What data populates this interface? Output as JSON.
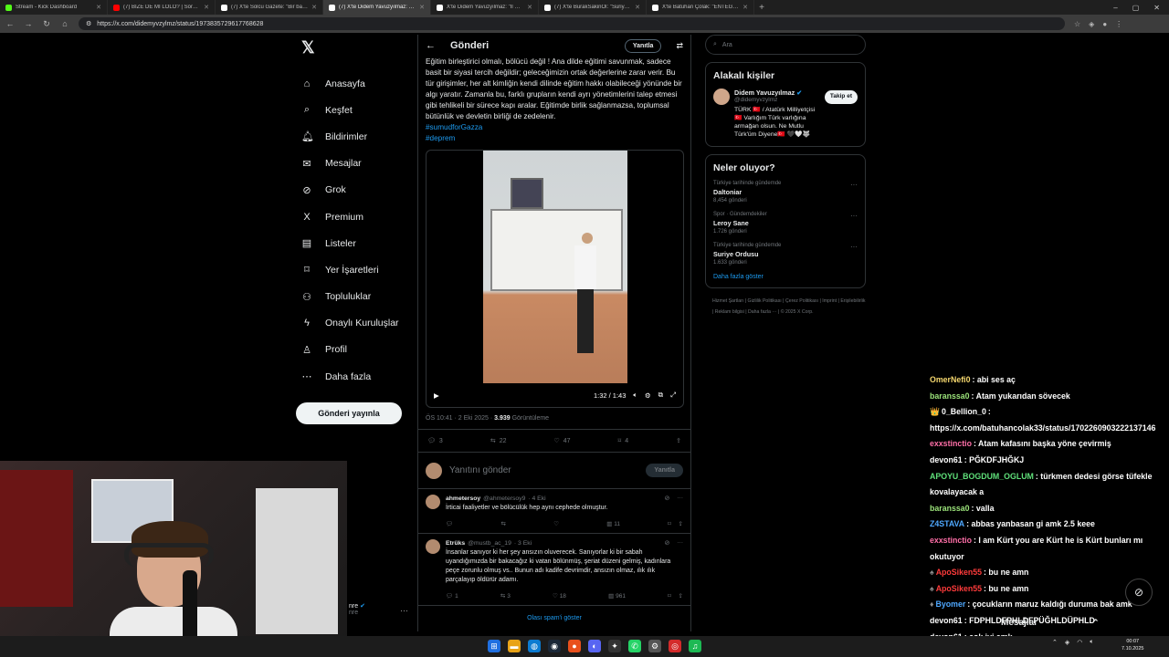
{
  "browser": {
    "tabs": [
      {
        "title": "Stream - Kick Dashboard",
        "color": "#53fc18",
        "active": false
      },
      {
        "title": "(7) BİZE DE Mİ LOLO? | Sörders |",
        "color": "#ff0000",
        "active": false
      },
      {
        "title": "(7) X'te Solcu Gazete: \"Bir baba, k",
        "color": "#ffffff",
        "active": false
      },
      {
        "title": "(7) X'te Didem Yavuzyılmaz: \"İl Mi",
        "color": "#ffffff",
        "active": true
      },
      {
        "title": "X'te Didem Yavuzyılmaz: \"İl MİLL",
        "color": "#ffffff",
        "active": false
      },
      {
        "title": "(7) X'te BurakSakinOl: \"Suriye'de",
        "color": "#ffffff",
        "active": false
      },
      {
        "title": "X'te Batuhan Çolak: \"ENTEGRASY",
        "color": "#ffffff",
        "active": false
      }
    ],
    "url": "https://x.com/didemyvzylmz/status/1973835729617768628"
  },
  "nav": {
    "items": [
      {
        "label": "Anasayfa",
        "icon": "⌂",
        "icon_name": "home-icon"
      },
      {
        "label": "Keşfet",
        "icon": "⌕",
        "icon_name": "explore-icon"
      },
      {
        "label": "Bildirimler",
        "icon": "🔔︎",
        "icon_name": "bell-icon",
        "badge": "7"
      },
      {
        "label": "Mesajlar",
        "icon": "✉",
        "icon_name": "mail-icon"
      },
      {
        "label": "Grok",
        "icon": "⊘",
        "icon_name": "grok-icon"
      },
      {
        "label": "Premium",
        "icon": "X",
        "icon_name": "premium-icon"
      },
      {
        "label": "Listeler",
        "icon": "▤",
        "icon_name": "list-icon"
      },
      {
        "label": "Yer İşaretleri",
        "icon": "⌑",
        "icon_name": "bookmark-icon"
      },
      {
        "label": "Topluluklar",
        "icon": "⚇",
        "icon_name": "communities-icon"
      },
      {
        "label": "Onaylı Kuruluşlar",
        "icon": "ϟ",
        "icon_name": "verified-orgs-icon"
      },
      {
        "label": "Profil",
        "icon": "♙",
        "icon_name": "profile-icon"
      },
      {
        "label": "Daha fazla",
        "icon": "⋯",
        "icon_name": "more-icon"
      }
    ],
    "post_button": "Gönderi yayınla",
    "account_name": "nre",
    "account_handle": "nre"
  },
  "post": {
    "header_title": "Gönderi",
    "reply_pill": "Yanıtla",
    "text": "Eğitim birleştirici olmalı, bölücü değil ! Ana dilde eğitimi savunmak, sadece basit bir siyasi tercih değildir; geleceğimizin ortak değerlerine zarar verir. Bu tür girişimler, her alt kimliğin kendi dilinde eğitim hakkı olabileceği yönünde bir algı yaratır. Zamanla bu, farklı grupların kendi ayrı yönetimlerini talep etmesi gibi tehlikeli bir sürece kapı aralar. Eğitimde birlik sağlanmazsa, toplumsal bütünlük ve devletin birliği de zedelenir.",
    "hashtags": [
      "#sumudforGazza",
      "#deprem"
    ],
    "video_time": "1:32 / 1:43",
    "time": "ÖS 10:41 · 2 Eki 2025 ·",
    "views": "3.939",
    "views_label": "Görüntüleme",
    "counts": {
      "replies": "3",
      "reposts": "22",
      "likes": "47",
      "bookmarks": "4"
    },
    "compose_placeholder": "Yanıtını gönder",
    "compose_button": "Yanıtla"
  },
  "replies": [
    {
      "name": "ahmetersoy",
      "handle": "@ahmetersoy9",
      "date": "· 4 Eki",
      "text": "İrticai faaliyetler ve bölücülük hep aynı cephede olmuştur.",
      "replies": "",
      "reposts": "",
      "likes": "",
      "views": "11"
    },
    {
      "name": "Etrüks",
      "handle": "@mustb_ac_19",
      "date": "· 3 Eki",
      "text": "İnsanlar sanıyor ki her şey ansızın oluverecek. Sanıyorlar ki bir sabah uyandığımızda bir bakacağız ki vatan bölünmüş, şeriat düzeni gelmiş, kadınlara peçe zorunlu olmuş vs.. Bunun adı kadife devrimdir, ansızın olmaz, ılık ılık parçalayıp öldürür adamı.",
      "replies": "1",
      "reposts": "3",
      "likes": "18",
      "views": "961"
    }
  ],
  "spam_link": "Olası spam'i göster",
  "sidebar": {
    "search_placeholder": "Ara",
    "relevant_title": "Alakalı kişiler",
    "person": {
      "name": "Didem Yavuzyılmaz",
      "handle": "@didemyvzylmz",
      "follow": "Takip et",
      "bio": "TÜRK 🇹🇷 / Atatürk Milliyetçisi 🇹🇷 Varlığım Türk varlığına armağan olsun. Ne Mutlu Türk'üm Diyene🇹🇷 🖤🤍🐺"
    },
    "trends_title": "Neler oluyor?",
    "trends": [
      {
        "context": "Türkiye tarihinde gündemde",
        "name": "Daltoniar",
        "count": "8,454 gönderi"
      },
      {
        "context": "Spor · Gündemdekiler",
        "name": "Leroy Sane",
        "count": "1.726 gönderi"
      },
      {
        "context": "Türkiye tarihinde gündemde",
        "name": "Suriye Ordusu",
        "count": "1.633 gönderi"
      }
    ],
    "show_more": "Daha fazla göster",
    "footer": [
      "Hizmet Şartları",
      "Gizlilik Politikası",
      "Çerez Politikası",
      "Imprint",
      "Erişilebilirlik",
      "Reklam bilgisi",
      "Daha fazla ···",
      "© 2025 X Corp."
    ]
  },
  "chat": [
    {
      "user": "OmerNefi0",
      "color": "#f5d76e",
      "text": "abi ses aç"
    },
    {
      "user": "baranssa0",
      "color": "#9be37a",
      "text": "Atam yukarıdan sövecek"
    },
    {
      "user": "0_Bellion_0",
      "color": "#ffffff",
      "text": "https://x.com/batuhancolak33/status/1702260903222137146",
      "badge": "👑"
    },
    {
      "user": "exxstinctio",
      "color": "#ff6fa8",
      "text": "Atam kafasını başka yöne çevirmiş"
    },
    {
      "user": "devon61",
      "color": "#ffffff",
      "text": "PĞKDFJHĞKJ"
    },
    {
      "user": "APOYU_BOGDUM_OGLUM",
      "color": "#5fe07a",
      "text": "türkmen dedesi görse tüfekle kovalayacak a"
    },
    {
      "user": "baranssa0",
      "color": "#9be37a",
      "text": "valla"
    },
    {
      "user": "Z4STAVA",
      "color": "#4fa8ff",
      "text": "abbas yanbasan gi amk 2.5 keee"
    },
    {
      "user": "exxstinctio",
      "color": "#ff6fa8",
      "text": "I am Kürt you are Kürt he is Kürt bunları mı okutuyor"
    },
    {
      "user": "ApoSiken55",
      "color": "#ff3b3b",
      "text": "bu ne amn",
      "badge_lite": "♠"
    },
    {
      "user": "ApoSiken55",
      "color": "#ff3b3b",
      "text": "bu ne amn",
      "badge_lite": "♠"
    },
    {
      "user": "Byomer",
      "color": "#4fa8ff",
      "text": "çocukların maruz kaldığı duruma bak amk",
      "badge_lite": "♦"
    },
    {
      "user": "devon61",
      "color": "#ffffff",
      "text": "FDPHLDFPHLDFPÜĞHLDÜPHLD"
    },
    {
      "user": "devon61",
      "color": "#ffffff",
      "text": "çok iyi amk"
    }
  ],
  "dm_label": "Mesajlar",
  "clock": {
    "time": "00:07",
    "date": "7.10.2025"
  }
}
